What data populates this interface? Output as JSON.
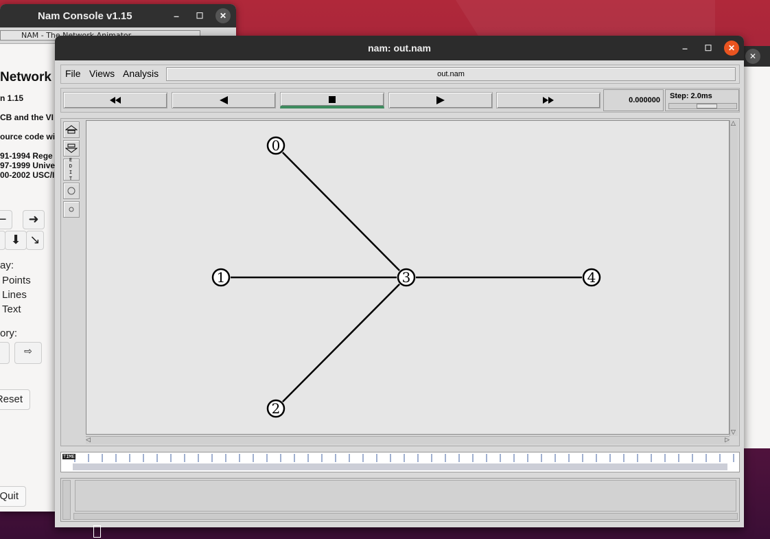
{
  "console": {
    "title": "Nam Console v1.15",
    "strip_text": "NAM - The Network Animator",
    "line_heading": "Network A",
    "line_version": "n 1.15",
    "line_cb": "CB and the VI",
    "line_source": "ource code wi",
    "line_c1": "91-1994 Rege",
    "line_c2": "97-1999 Unive",
    "line_c3": "00-2002 USC/I",
    "display_label": "ay:",
    "opt_points": "Points",
    "opt_lines": "Lines",
    "opt_text": "Text",
    "history_label": "ory:",
    "reset_label": "Reset",
    "quit_label": "Quit"
  },
  "nam": {
    "title": "nam: out.nam",
    "menu": {
      "file": "File",
      "views": "Views",
      "analysis": "Analysis"
    },
    "file_field": "out.nam",
    "time_value": "0.000000",
    "step_label": "Step: 2.0ms",
    "edit_tool": "EDIT"
  },
  "topology": {
    "nodes": [
      "0",
      "1",
      "2",
      "3",
      "4"
    ],
    "links": [
      [
        "0",
        "3"
      ],
      [
        "1",
        "3"
      ],
      [
        "2",
        "3"
      ],
      [
        "3",
        "4"
      ]
    ]
  }
}
